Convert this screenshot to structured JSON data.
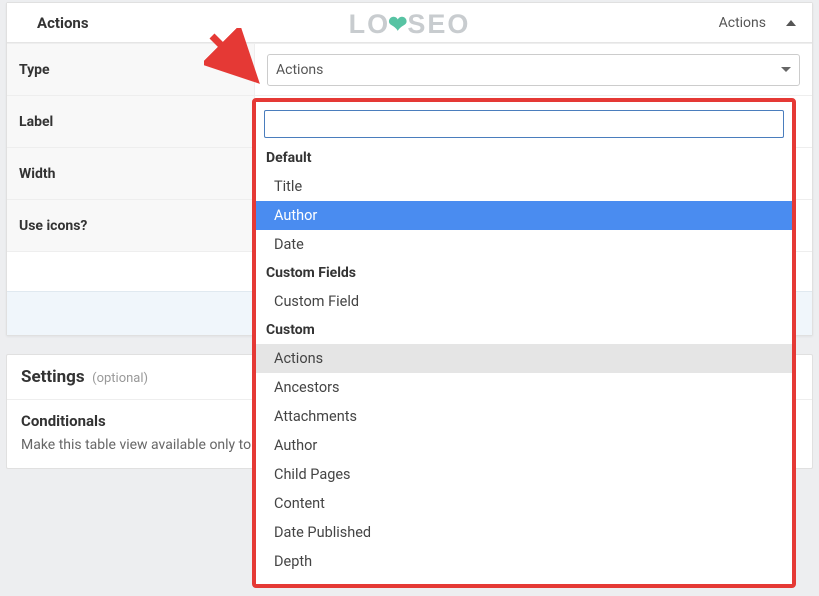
{
  "watermark": "LOYSEO",
  "panel": {
    "title": "Actions",
    "header_right_text": "Actions"
  },
  "form": {
    "rows": [
      {
        "label": "Type",
        "value": "Actions"
      },
      {
        "label": "Label",
        "value": ""
      },
      {
        "label": "Width",
        "value": ""
      },
      {
        "label": "Use icons?",
        "value": ""
      }
    ]
  },
  "settings": {
    "title": "Settings",
    "optional": "(optional)",
    "conditionals_title": "Conditionals",
    "conditionals_desc": "Make this table view available only to specific users or roles."
  },
  "dropdown": {
    "search_value": "",
    "groups": [
      {
        "label": "Default",
        "options": [
          {
            "text": "Title",
            "highlighted": false,
            "selected": false
          },
          {
            "text": "Author",
            "highlighted": true,
            "selected": false
          },
          {
            "text": "Date",
            "highlighted": false,
            "selected": false
          }
        ]
      },
      {
        "label": "Custom Fields",
        "options": [
          {
            "text": "Custom Field",
            "highlighted": false,
            "selected": false
          }
        ]
      },
      {
        "label": "Custom",
        "options": [
          {
            "text": "Actions",
            "highlighted": false,
            "selected": true
          },
          {
            "text": "Ancestors",
            "highlighted": false,
            "selected": false
          },
          {
            "text": "Attachments",
            "highlighted": false,
            "selected": false
          },
          {
            "text": "Author",
            "highlighted": false,
            "selected": false
          },
          {
            "text": "Child Pages",
            "highlighted": false,
            "selected": false
          },
          {
            "text": "Content",
            "highlighted": false,
            "selected": false
          },
          {
            "text": "Date Published",
            "highlighted": false,
            "selected": false
          },
          {
            "text": "Depth",
            "highlighted": false,
            "selected": false
          }
        ]
      }
    ]
  }
}
